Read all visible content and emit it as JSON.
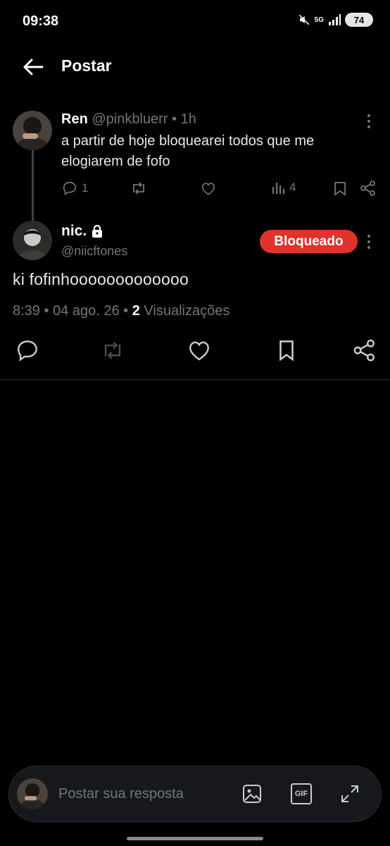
{
  "status": {
    "time": "09:38",
    "network": "5G",
    "battery": "74"
  },
  "header": {
    "title": "Postar"
  },
  "parent_post": {
    "name": "Ren",
    "handle": "@pinkbluerr",
    "separator": "•",
    "age": "1h",
    "text": "a partir de hoje bloquearei todos que me elogiarem de fofo",
    "replies": "1",
    "views": "4"
  },
  "main_post": {
    "name": "nic.",
    "handle": "@niicftones",
    "blocked_label": "Bloqueado",
    "text": "ki fofinhooooooooooooo",
    "time": "8:39",
    "date": "04 ago. 26",
    "views_count": "2",
    "views_label": "Visualizações"
  },
  "reply": {
    "placeholder": "Postar sua resposta",
    "gif_label": "GIF"
  },
  "colors": {
    "accent_blocked": "#e0332c",
    "muted": "#71767b",
    "background": "#000000"
  }
}
